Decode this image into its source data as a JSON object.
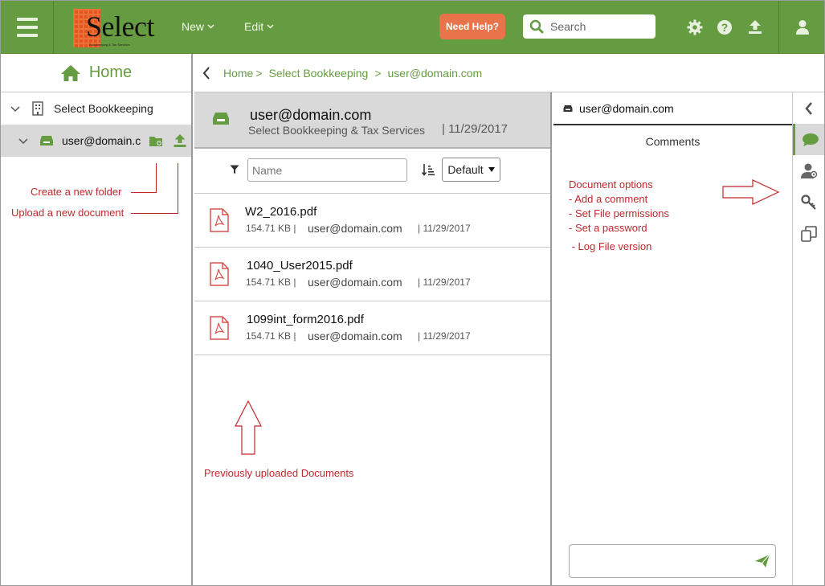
{
  "topbar": {
    "logo_text": "Select",
    "logo_tagline": "Bookkeeping & Tax Services",
    "menu_new": "New",
    "menu_edit": "Edit",
    "help_label": "Need Help?",
    "search_placeholder": "Search",
    "icons": [
      "menu-icon",
      "gear-icon",
      "help-icon",
      "upload-icon",
      "user-icon"
    ]
  },
  "sidebar": {
    "home_label": "Home",
    "tree": [
      {
        "label": "Select Bookkeeping",
        "icon": "building-icon"
      },
      {
        "label": "user@domain.c",
        "icon": "drive-icon",
        "selected": true
      }
    ]
  },
  "annotations": {
    "create_folder": "Create a new folder",
    "upload_document": "Upload a new document",
    "previous_docs": "Previously uploaded Documents",
    "doc_options_title": "Document options",
    "doc_options": [
      "- Add a comment",
      "- Set File permissions",
      "- Set a password",
      " - Log File version"
    ]
  },
  "breadcrumb": {
    "items": [
      "Home",
      "Select Bookkeeping",
      "user@domain.com"
    ],
    "separator": ">"
  },
  "folder_header": {
    "title": "user@domain.com",
    "subtitle": "Select Bookkeeping & Tax Services",
    "date": "| 11/29/2017"
  },
  "filter": {
    "placeholder": "Name",
    "sort_value": "Default"
  },
  "documents": [
    {
      "name": "W2_2016.pdf",
      "size": "154.71 KB |",
      "owner": "user@domain.com",
      "date": "| 11/29/2017"
    },
    {
      "name": "1040_User2015.pdf",
      "size": "154.71 KB |",
      "owner": "user@domain.com",
      "date": "| 11/29/2017"
    },
    {
      "name": "1099int_form2016.pdf",
      "size": "154.71 KB |",
      "owner": "user@domain.com",
      "date": "| 11/29/2017"
    }
  ],
  "detail": {
    "header": "user@domain.com",
    "section_title": "Comments"
  },
  "colors": {
    "brand_green": "#669c41",
    "help_orange": "#e9744c",
    "annotation_red": "#c0282d",
    "pdf_red": "#d9534f"
  }
}
